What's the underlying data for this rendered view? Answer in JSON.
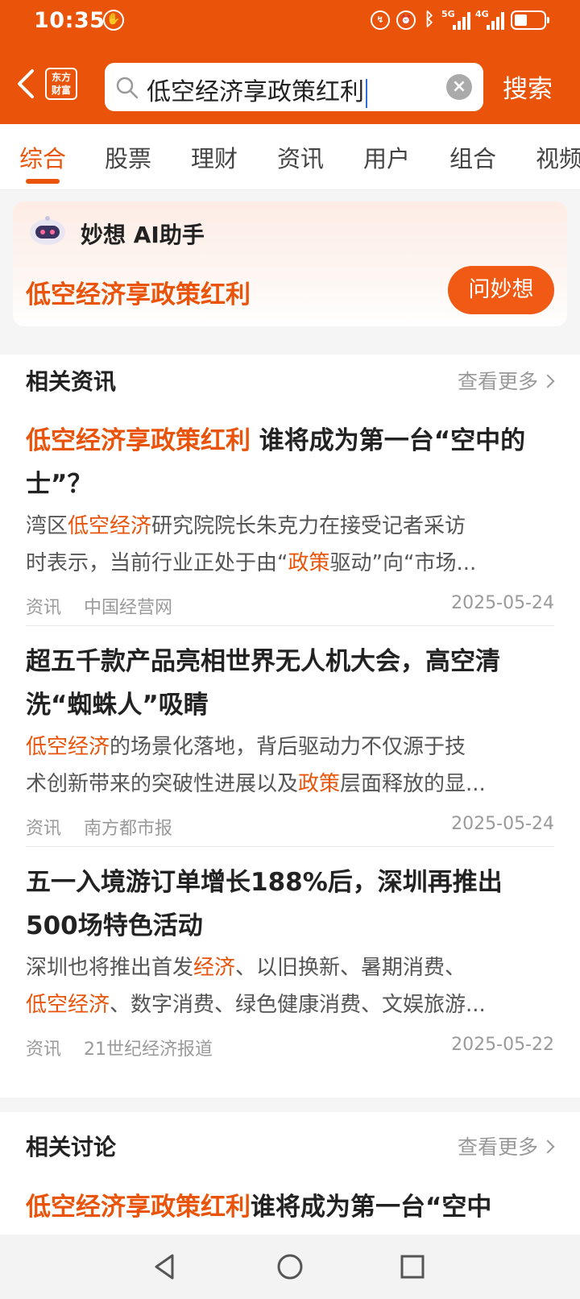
{
  "status": {
    "time": "10:35",
    "net1": "5G",
    "net2": "4G"
  },
  "header": {
    "logo_line1": "东方",
    "logo_line2": "财富",
    "query": "低空经济享政策红利",
    "search_label": "搜索"
  },
  "tabs": [
    "综合",
    "股票",
    "理财",
    "资讯",
    "用户",
    "组合",
    "视频"
  ],
  "ai": {
    "title": "妙想 AI助手",
    "question": "低空经济享政策红利",
    "button": "问妙想"
  },
  "news_section": {
    "title": "相关资讯",
    "more": "查看更多",
    "items": [
      {
        "title_hl": "低空经济享政策红利",
        "title_rest": " 谁将成为第一台“空中的士”？",
        "s1": "湾区",
        "s2": "低空经济",
        "s3": "研究院院长朱克力在接受记者采访",
        "s4": "时表示，当前行业正处于由“",
        "s5": "政策",
        "s6": "驱动”向“市场...",
        "category": "资讯",
        "source": "中国经营网",
        "date": "2025-05-24"
      },
      {
        "title": "超五千款产品亮相世界无人机大会，高空清洗“蜘蛛人”吸睛",
        "s1": "低空经济",
        "s2": "的场景化落地，背后驱动力不仅源于技",
        "s3": "术创新带来的突破性进展以及",
        "s4": "政策",
        "s5": "层面释放的显...",
        "category": "资讯",
        "source": "南方都市报",
        "date": "2025-05-24"
      },
      {
        "title": "五一入境游订单增长188%后，深圳再推出500场特色活动",
        "s1": "深圳也将推出首发",
        "s2": "经济",
        "s3": "、以旧换新、暑期消费、",
        "s4": "低空经济",
        "s5": "、数字消费、绿色健康消费、文娱旅游...",
        "category": "资讯",
        "source": "21世纪经济报道",
        "date": "2025-05-22"
      }
    ]
  },
  "discussion_section": {
    "title": "相关讨论",
    "more": "查看更多",
    "first_hl": "低空经济享政策红利",
    "first_rest": "谁将成为第一台“空中"
  },
  "colors": {
    "brand": "#e9540a",
    "highlight": "#e9540a"
  },
  "icons": [
    "back-arrow-icon",
    "search-icon",
    "clear-icon",
    "chevron-right-icon",
    "robot-icon",
    "nav-back-icon",
    "nav-home-icon",
    "nav-recents-icon"
  ]
}
